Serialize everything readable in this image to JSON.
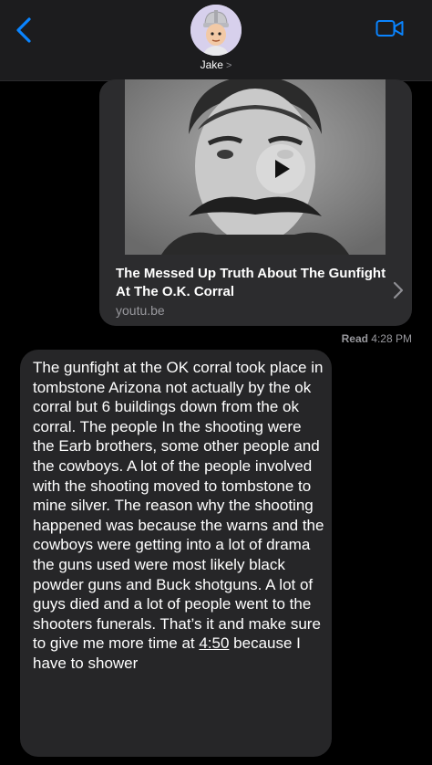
{
  "header": {
    "contact_name": "Jake",
    "chevron": ">",
    "back_icon": "chevron-left-icon",
    "video_icon": "video-camera-icon",
    "accent": "#0a84ff"
  },
  "link_preview": {
    "title": "The Messed Up Truth About The Gunfight At The O.K. Corral",
    "domain": "youtu.be"
  },
  "receipt": {
    "status": "Read",
    "time": "4:28 PM"
  },
  "message": {
    "text_before": "The gunfight at the OK corral took place in tombstone Arizona not actually by the ok corral but 6 buildings down from the ok corral. The people In the shooting were the Earb brothers, some other people and the cowboys. A lot of the people involved with the shooting moved to tombstone to mine silver. The reason why the shooting happened was because the warns and the cowboys were getting into a lot of drama the guns used were most likely black powder guns and Buck shotguns. A lot of guys died and a lot of people went to the shooters funerals. That’s it and make sure to give me more time at ",
    "time_link": "4:50",
    "text_after": " because I have to shower"
  }
}
